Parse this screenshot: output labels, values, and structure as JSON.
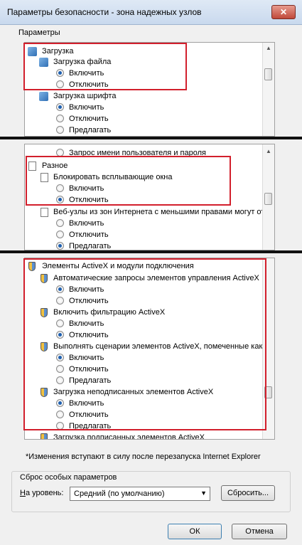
{
  "window": {
    "title": "Параметры безопасности - зона надежных узлов",
    "close_glyph": "✕"
  },
  "group_caption": "Параметры",
  "panel1": {
    "items": [
      {
        "label": "Загрузка"
      },
      {
        "label": "Загрузка файла"
      },
      {
        "label": "Включить",
        "checked": true
      },
      {
        "label": "Отключить",
        "checked": false
      },
      {
        "label": "Загрузка шрифта"
      },
      {
        "label": "Включить",
        "checked": true
      },
      {
        "label": "Отключить",
        "checked": false
      },
      {
        "label": "Предлагать",
        "checked": false
      }
    ]
  },
  "panel2": {
    "items": [
      {
        "label": "Запрос имени пользователя и пароля"
      },
      {
        "label": "Разное"
      },
      {
        "label": "Блокировать всплывающие окна"
      },
      {
        "label": "Включить",
        "checked": false
      },
      {
        "label": "Отключить",
        "checked": true
      },
      {
        "label": "Веб-узлы из зон Интернета с меньшими правами могут от"
      },
      {
        "label": "Включить",
        "checked": false
      },
      {
        "label": "Отключить",
        "checked": false
      },
      {
        "label": "Предлагать",
        "checked": true
      }
    ]
  },
  "panel3": {
    "items": [
      {
        "label": "Элементы ActiveX и модули подключения"
      },
      {
        "label": "Автоматические запросы элементов управления ActiveX"
      },
      {
        "label": "Включить",
        "checked": true
      },
      {
        "label": "Отключить",
        "checked": false
      },
      {
        "label": "Включить фильтрацию ActiveX"
      },
      {
        "label": "Включить",
        "checked": false
      },
      {
        "label": "Отключить",
        "checked": true
      },
      {
        "label": "Выполнять сценарии элементов ActiveX, помеченные как"
      },
      {
        "label": "Включить",
        "checked": true
      },
      {
        "label": "Отключить",
        "checked": false
      },
      {
        "label": "Предлагать",
        "checked": false
      },
      {
        "label": "Загрузка неподписанных элементов ActiveX"
      },
      {
        "label": "Включить",
        "checked": true
      },
      {
        "label": "Отключить",
        "checked": false
      },
      {
        "label": "Предлагать",
        "checked": false
      },
      {
        "label": "Загрузка подписанных элементов ActiveX"
      }
    ]
  },
  "restart_note": "*Изменения вступают в силу после перезапуска Internet Explorer",
  "reset": {
    "caption": "Сброс особых параметров",
    "level_hotkey": "Н",
    "level_label_rest": "а уровень:",
    "level_value": "Средний (по умолчанию)",
    "reset_button": "Сбросить..."
  },
  "buttons": {
    "ok": "ОК",
    "cancel": "Отмена"
  }
}
